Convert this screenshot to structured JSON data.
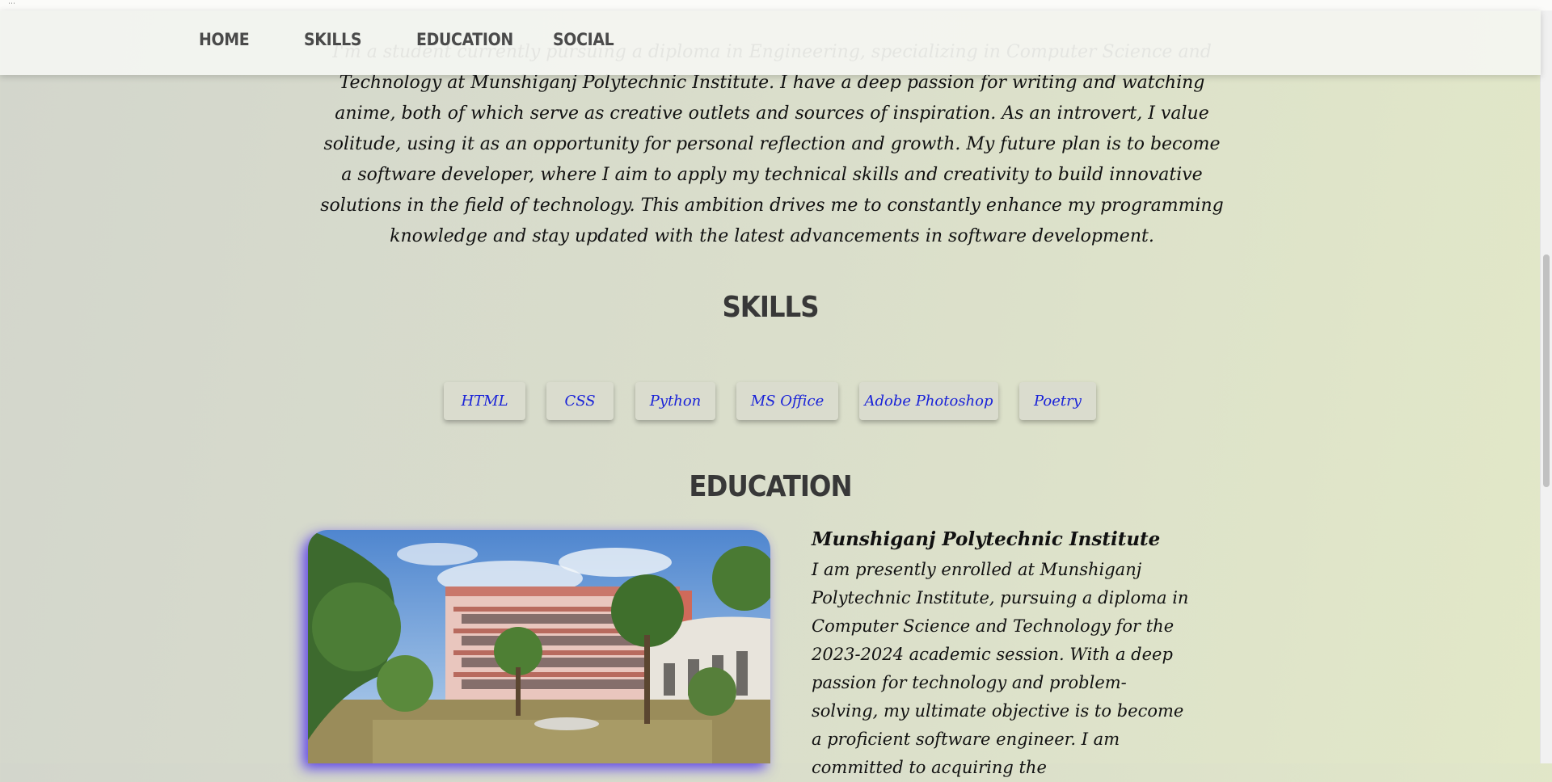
{
  "nav": {
    "items": [
      {
        "label": "HOME"
      },
      {
        "label": "SKILLS"
      },
      {
        "label": "EDUCATION"
      },
      {
        "label": "SOCIAL"
      }
    ]
  },
  "about": {
    "text": "I'm a student currently pursuing a diploma in Engineering, specializing in Computer Science and Technology at Munshiganj Polytechnic Institute. I have a deep passion for writing and watching anime, both of which serve as creative outlets and sources of inspiration. As an introvert, I value solitude, using it as an opportunity for personal reflection and growth. My future plan is to become a software developer, where I aim to apply my technical skills and creativity to build innovative solutions in the field of technology. This ambition drives me to constantly enhance my programming knowledge and stay updated with the latest advancements in software development."
  },
  "skills": {
    "title": "SKILLS",
    "items": [
      "HTML",
      "CSS",
      "Python",
      "MS Office",
      "Adobe Photoshop",
      "Poetry"
    ]
  },
  "education": {
    "title": "EDUCATION",
    "institute": "Munshiganj Polytechnic Institute",
    "description": "I am presently enrolled at Munshiganj Polytechnic Institute, pursuing a diploma in Computer Science and Technology for the 2023-2024 academic session. With a deep passion for technology and problem-solving, my ultimate objective is to become a proficient software engineer. I am committed to acquiring the"
  },
  "colors": {
    "skill_text": "#1a23d8",
    "photo_glow": "#4628f0",
    "heading": "#383838"
  }
}
